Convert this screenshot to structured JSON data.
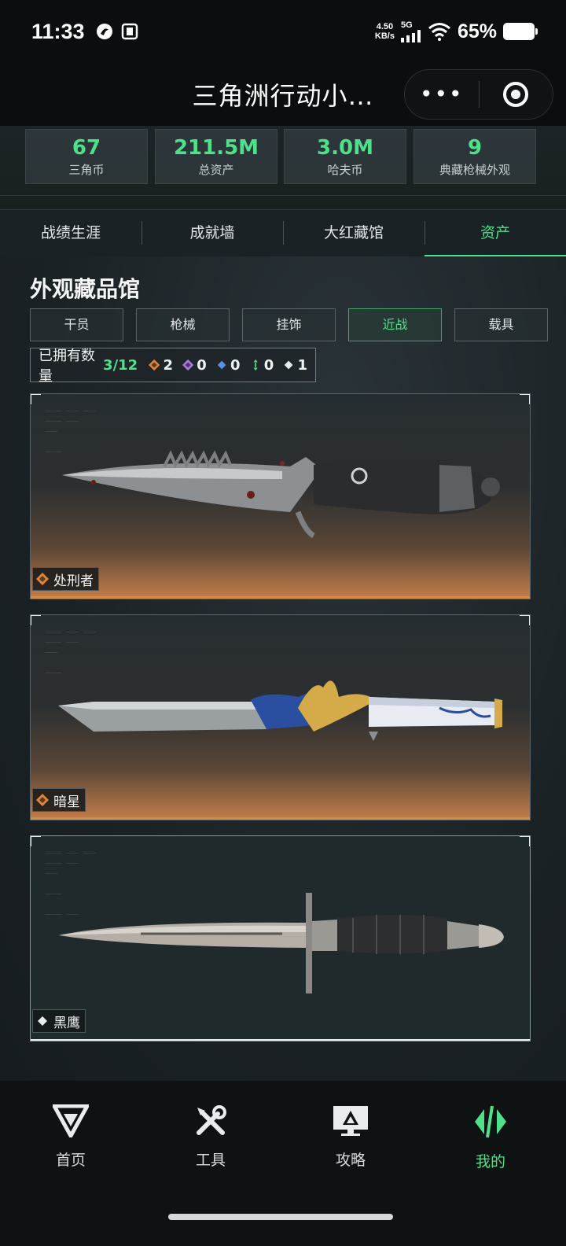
{
  "status_bar": {
    "time": "11:33",
    "speed_value": "4.50",
    "speed_unit": "KB/s",
    "network": "5G",
    "battery": "65%"
  },
  "title_bar": {
    "title": "三角洲行动小…",
    "more_label": "•••"
  },
  "stats": [
    {
      "value": "67",
      "label": "三角币"
    },
    {
      "value": "211.5M",
      "label": "总资产"
    },
    {
      "value": "3.0M",
      "label": "哈夫币"
    },
    {
      "value": "9",
      "label": "典藏枪械外观"
    }
  ],
  "tabs": [
    {
      "label": "战绩生涯",
      "active": false
    },
    {
      "label": "成就墙",
      "active": false
    },
    {
      "label": "大红藏馆",
      "active": false
    },
    {
      "label": "资产",
      "active": true
    }
  ],
  "section_title": "外观藏品馆",
  "filters": [
    {
      "label": "干员",
      "active": false
    },
    {
      "label": "枪械",
      "active": false
    },
    {
      "label": "挂饰",
      "active": false
    },
    {
      "label": "近战",
      "active": true
    },
    {
      "label": "载具",
      "active": false
    }
  ],
  "owned": {
    "label": "已拥有数量",
    "count": "3/12",
    "rarity_counts": [
      {
        "icon": "orange-gem-icon",
        "color": "#e0843c",
        "count": "2"
      },
      {
        "icon": "purple-gem-icon",
        "color": "#a77be0",
        "count": "0"
      },
      {
        "icon": "blue-gem-icon",
        "color": "#5d8fe0",
        "count": "0"
      },
      {
        "icon": "green-gem-icon",
        "color": "#4fe08a",
        "count": "0"
      },
      {
        "icon": "white-gem-icon",
        "color": "#e8ecee",
        "count": "1"
      }
    ]
  },
  "cards": [
    {
      "name": "处刑者",
      "rarity": "orange"
    },
    {
      "name": "暗星",
      "rarity": "orange"
    },
    {
      "name": "黑鹰",
      "rarity": "white"
    }
  ],
  "bottom_nav": [
    {
      "label": "首页",
      "icon": "home-logo-icon",
      "active": false
    },
    {
      "label": "工具",
      "icon": "tools-icon",
      "active": false
    },
    {
      "label": "攻略",
      "icon": "guide-monitor-icon",
      "active": false
    },
    {
      "label": "我的",
      "icon": "profile-logo-icon",
      "active": true
    }
  ],
  "colors": {
    "accent": "#4fe08a",
    "orange_rarity": "#d78a45"
  }
}
